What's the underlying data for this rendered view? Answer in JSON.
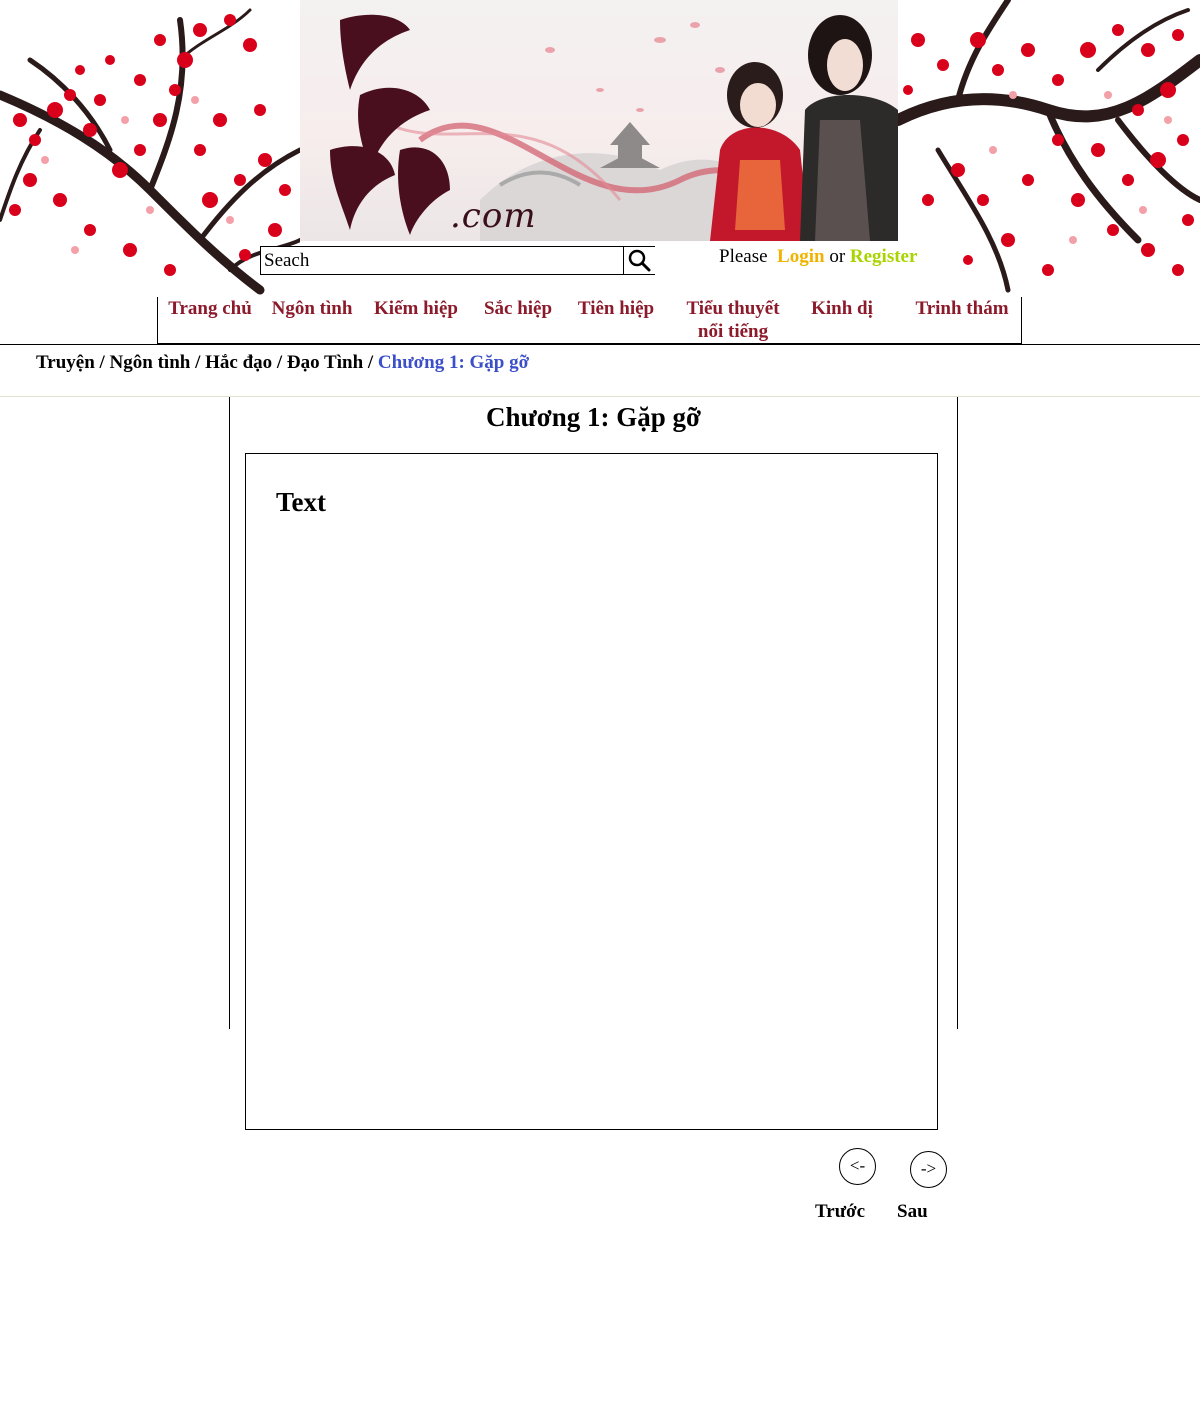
{
  "search": {
    "placeholder": "Seach"
  },
  "auth": {
    "prefix": "Please",
    "login": "Login",
    "or": "or",
    "register": "Register"
  },
  "nav": {
    "items": [
      {
        "label": "Trang chủ"
      },
      {
        "label": "Ngôn tình"
      },
      {
        "label": "Kiếm hiệp"
      },
      {
        "label": "Sắc hiệp"
      },
      {
        "label": "Tiên hiệp"
      },
      {
        "label": "Tiểu thuyết nổi tiếng"
      },
      {
        "label": "Kinh dị"
      },
      {
        "label": "Trinh thám"
      }
    ]
  },
  "breadcrumb": {
    "items": [
      "Truyện",
      "Ngôn tình",
      "Hắc đạo",
      "Đạo Tình"
    ],
    "separator": "/",
    "current": "Chương 1: Gặp gỡ"
  },
  "chapter": {
    "title": "Chương 1: Gặp gỡ",
    "content": "Text"
  },
  "logo": {
    "text": ".com"
  },
  "pager": {
    "prev_symbol": "<-",
    "next_symbol": "->",
    "prev_label": "Trước",
    "next_label": "Sau"
  },
  "colors": {
    "nav_text": "#8b1a2b",
    "login": "#f0b400",
    "register": "#a9d400",
    "breadcrumb_current": "#3a4fc8",
    "blossom": "#d9001b"
  }
}
